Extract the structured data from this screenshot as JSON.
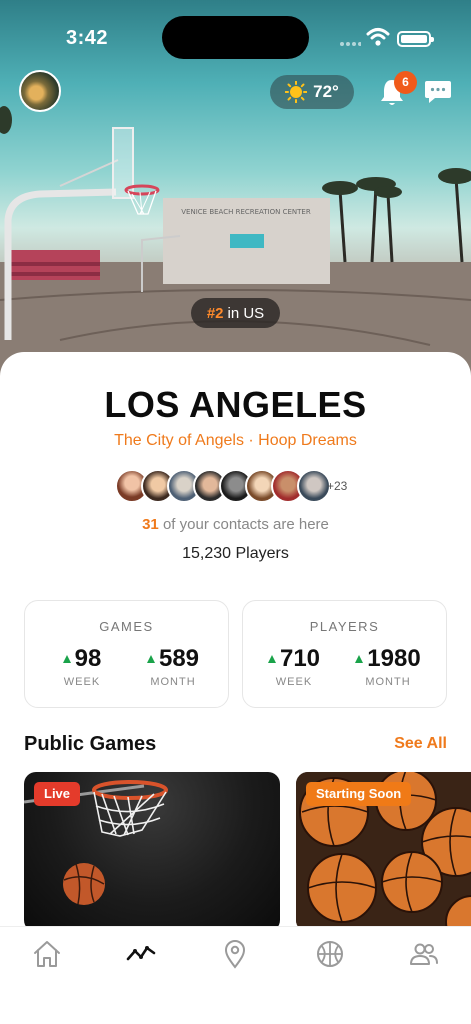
{
  "status_bar": {
    "time": "3:42"
  },
  "header": {
    "weather_temp": "72°",
    "notification_count": "6",
    "rank_prefix": "#2",
    "rank_suffix": "in US",
    "hero_sign": "VENICE BEACH RECREATION CENTER"
  },
  "city": {
    "name": "LOS ANGELES",
    "tagline": "The City of Angels · Hoop Dreams",
    "contacts_more": "+23",
    "contacts_count": "31",
    "contacts_text": "of your contacts are here",
    "players_text": "15,230 Players"
  },
  "stats": {
    "games": {
      "title": "GAMES",
      "week_value": "98",
      "week_label": "WEEK",
      "month_value": "589",
      "month_label": "MONTH"
    },
    "players": {
      "title": "PLAYERS",
      "week_value": "710",
      "week_label": "WEEK",
      "month_value": "1980",
      "month_label": "MONTH"
    }
  },
  "public_games": {
    "title": "Public Games",
    "see_all": "See All",
    "cards": [
      {
        "tag": "Live",
        "tag_color": "#e43b2b"
      },
      {
        "tag": "Starting Soon",
        "tag_color": "#f07a17"
      }
    ]
  },
  "tabbar": {
    "tabs": [
      {
        "icon": "home-icon",
        "active": false
      },
      {
        "icon": "activity-icon",
        "active": true
      },
      {
        "icon": "location-pin-icon",
        "active": false
      },
      {
        "icon": "basketball-icon",
        "active": false
      },
      {
        "icon": "people-icon",
        "active": false
      }
    ]
  },
  "colors": {
    "accent": "#ef7a1c",
    "badge": "#f05a1a",
    "up_arrow": "#1aa34a"
  }
}
